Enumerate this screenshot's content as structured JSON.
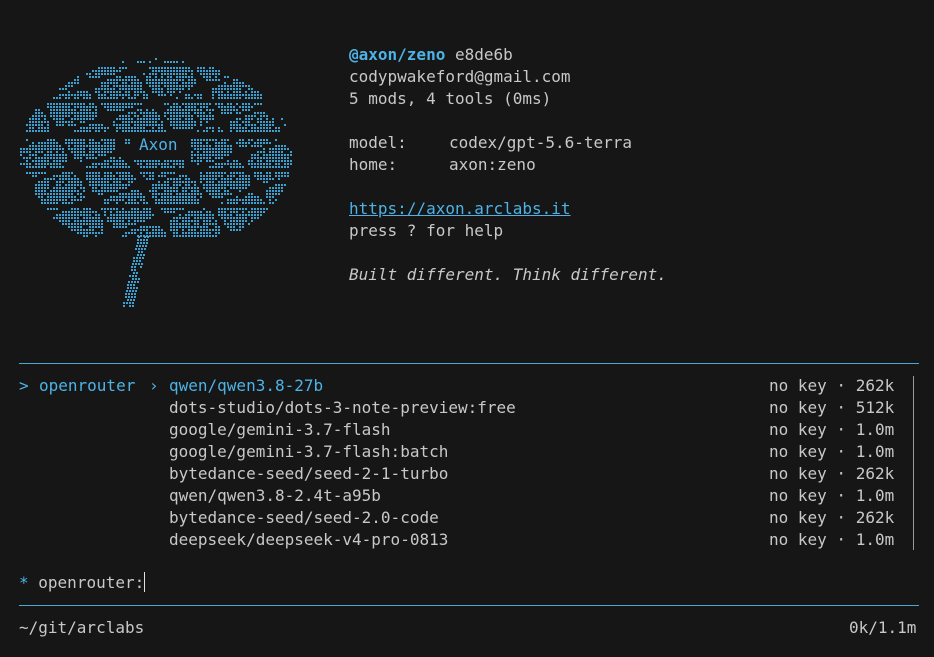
{
  "header": {
    "logo_text": "Axon",
    "handle": "@axon/zeno",
    "hash": "e8de6b",
    "email": "codypwakeford@gmail.com",
    "summary": "5 mods, 4 tools (0ms)",
    "model_label": "model:",
    "model_value": "codex/gpt-5.6-terra",
    "home_label": "home:",
    "home_value": "axon:zeno",
    "url": "https://axon.arclabs.it",
    "help": "press ? for help",
    "tagline": "Built different. Think different."
  },
  "model_picker": {
    "selector": ">",
    "provider": "openrouter",
    "separator": "›",
    "items": [
      {
        "name": "qwen/qwen3.8-27b",
        "status": "no key · 262k",
        "selected": true
      },
      {
        "name": "dots-studio/dots-3-note-preview:free",
        "status": "no key · 512k"
      },
      {
        "name": "google/gemini-3.7-flash",
        "status": "no key · 1.0m"
      },
      {
        "name": "google/gemini-3.7-flash:batch",
        "status": "no key · 1.0m"
      },
      {
        "name": "bytedance-seed/seed-2-1-turbo",
        "status": "no key · 262k"
      },
      {
        "name": "qwen/qwen3.8-2.4t-a95b",
        "status": "no key · 1.0m"
      },
      {
        "name": "bytedance-seed/seed-2.0-code",
        "status": "no key · 262k"
      },
      {
        "name": "deepseek/deepseek-v4-pro-0813",
        "status": "no key · 1.0m"
      }
    ]
  },
  "prompt": {
    "marker": "*",
    "text": "openrouter:"
  },
  "status_bar": {
    "cwd": "~/git/arclabs",
    "tokens": "0k/1.1m"
  },
  "colors": {
    "background": "#161616",
    "accent": "#4db3e6",
    "text": "#c8c8c8"
  }
}
